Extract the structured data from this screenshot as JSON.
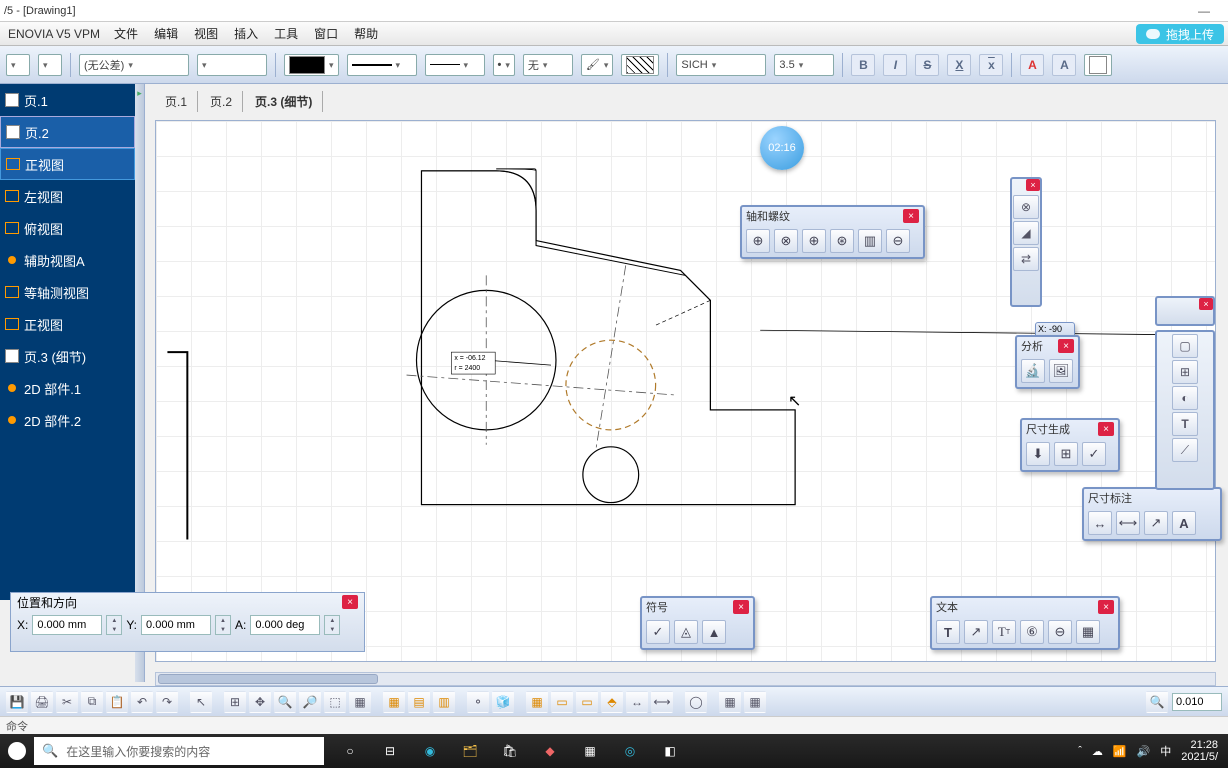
{
  "window": {
    "title": "/5 - [Drawing1]"
  },
  "menubar": {
    "brand": "ENOVIA V5 VPM",
    "items": [
      "文件",
      "编辑",
      "视图",
      "插入",
      "工具",
      "窗口",
      "帮助"
    ],
    "upload": "拖拽上传"
  },
  "toolstrip": {
    "tolerance": "(无公差)",
    "line_style": "无",
    "font": "SICH",
    "font_size": "3.5",
    "bold": "B",
    "italic": "I",
    "strike": "S",
    "xover": "X",
    "xover2": "x",
    "a1": "A",
    "a2": "A"
  },
  "tree": {
    "header": "页.1",
    "items": [
      {
        "label": "页.2",
        "kind": "sheet",
        "active": true
      },
      {
        "label": "正视图",
        "kind": "view",
        "highlight": true
      },
      {
        "label": "左视图",
        "kind": "view"
      },
      {
        "label": "俯视图",
        "kind": "view"
      },
      {
        "label": "辅助视图A",
        "kind": "view"
      },
      {
        "label": "等轴测视图",
        "kind": "view"
      },
      {
        "label": "正视图",
        "kind": "view"
      },
      {
        "label": "页.3 (细节)",
        "kind": "sheet"
      },
      {
        "label": "2D 部件.1",
        "kind": "part"
      },
      {
        "label": "2D 部件.2",
        "kind": "part"
      }
    ]
  },
  "tabs": [
    "页.1",
    "页.2",
    "页.3 (细节)"
  ],
  "bubble": "02:16",
  "palettes": {
    "axis_thread": "轴和螺纹",
    "analysis": "分析",
    "dim_gen": "尺寸生成",
    "dim_annot": "尺寸标注",
    "symbol": "符号",
    "text": "文本",
    "posdir": "位置和方向"
  },
  "posdir": {
    "x_label": "X:",
    "x_val": "0.000 mm",
    "y_label": "Y:",
    "y_val": "0.000 mm",
    "a_label": "A:",
    "a_val": "0.000 deg"
  },
  "coord_readout": "X: -90",
  "annot": {
    "line1": "x = -06.12",
    "line2": "r = 2400"
  },
  "cmdline": "命令",
  "zoom_val": "0.010",
  "taskbar": {
    "search_placeholder": "在这里输入你要搜索的内容",
    "ime": "中",
    "time": "21:28",
    "date": "2021/5/"
  },
  "text_palette": {
    "T": "T",
    "Tt": "T",
    "num": "6"
  }
}
